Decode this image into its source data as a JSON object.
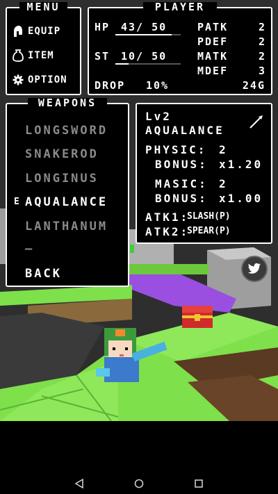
{
  "menu": {
    "title": "MENU",
    "items": [
      {
        "label": "EQUIP",
        "icon": "helmet-icon"
      },
      {
        "label": "ITEM",
        "icon": "bag-icon"
      },
      {
        "label": "OPTION",
        "icon": "gear-icon"
      }
    ]
  },
  "player": {
    "title": "PLAYER",
    "hp_label": "HP",
    "hp_value": "43/ 50",
    "st_label": "ST",
    "st_value": "10/ 50",
    "drop_label": "DROP",
    "drop_value": "10%",
    "gold": "24G",
    "stats": [
      {
        "label": "PATK",
        "value": "2"
      },
      {
        "label": "PDEF",
        "value": "2"
      },
      {
        "label": "MATK",
        "value": "2"
      },
      {
        "label": "MDEF",
        "value": "3"
      }
    ],
    "hp_fraction": 0.86,
    "st_fraction": 0.2
  },
  "weapons": {
    "title": "WEAPONS",
    "items": [
      "LONGSWORD",
      "SNAKEROD",
      "LONGINUS",
      "AQUALANCE",
      "LANTHANUM",
      "—"
    ],
    "equipped_marker": "E",
    "selected_index": 3,
    "back_label": "BACK"
  },
  "detail": {
    "level": "Lv2",
    "name": "AQUALANCE",
    "physic_label": "PHYSIC:",
    "physic_value": "2",
    "physic_bonus_label": "BONUS:",
    "physic_bonus_value": "x1.20",
    "masic_label": "MASIC:",
    "masic_value": "2",
    "masic_bonus_label": "BONUS:",
    "masic_bonus_value": "x1.00",
    "atk1_label": "ATK1:",
    "atk1_value": "SLASH(P)",
    "atk2_label": "ATK2:",
    "atk2_value": "SPEAR(P)"
  },
  "colors": {
    "grass": "#7ee04a",
    "grass_dark": "#5bb235",
    "purple": "#9a4fe0",
    "stone": "#a8a8a8",
    "chest": "#d02a2a"
  }
}
